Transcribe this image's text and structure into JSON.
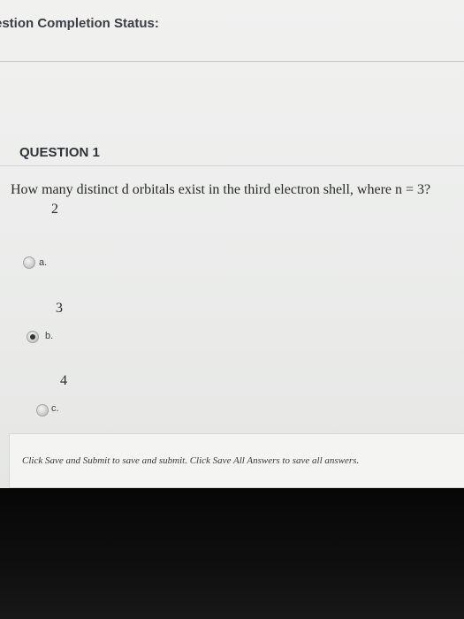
{
  "status": {
    "title": "estion Completion Status:"
  },
  "question": {
    "header": "QUESTION 1",
    "text": "How many distinct d orbitals exist in the third electron shell, where n = 3?",
    "options": [
      {
        "letter": "a.",
        "value": "2",
        "selected": false
      },
      {
        "letter": "b.",
        "value": "3",
        "selected": true
      },
      {
        "letter": "c.",
        "value": "4",
        "selected": false
      }
    ]
  },
  "footer": {
    "instruction": "Click Save and Submit to save and submit. Click Save All Answers to save all answers."
  }
}
